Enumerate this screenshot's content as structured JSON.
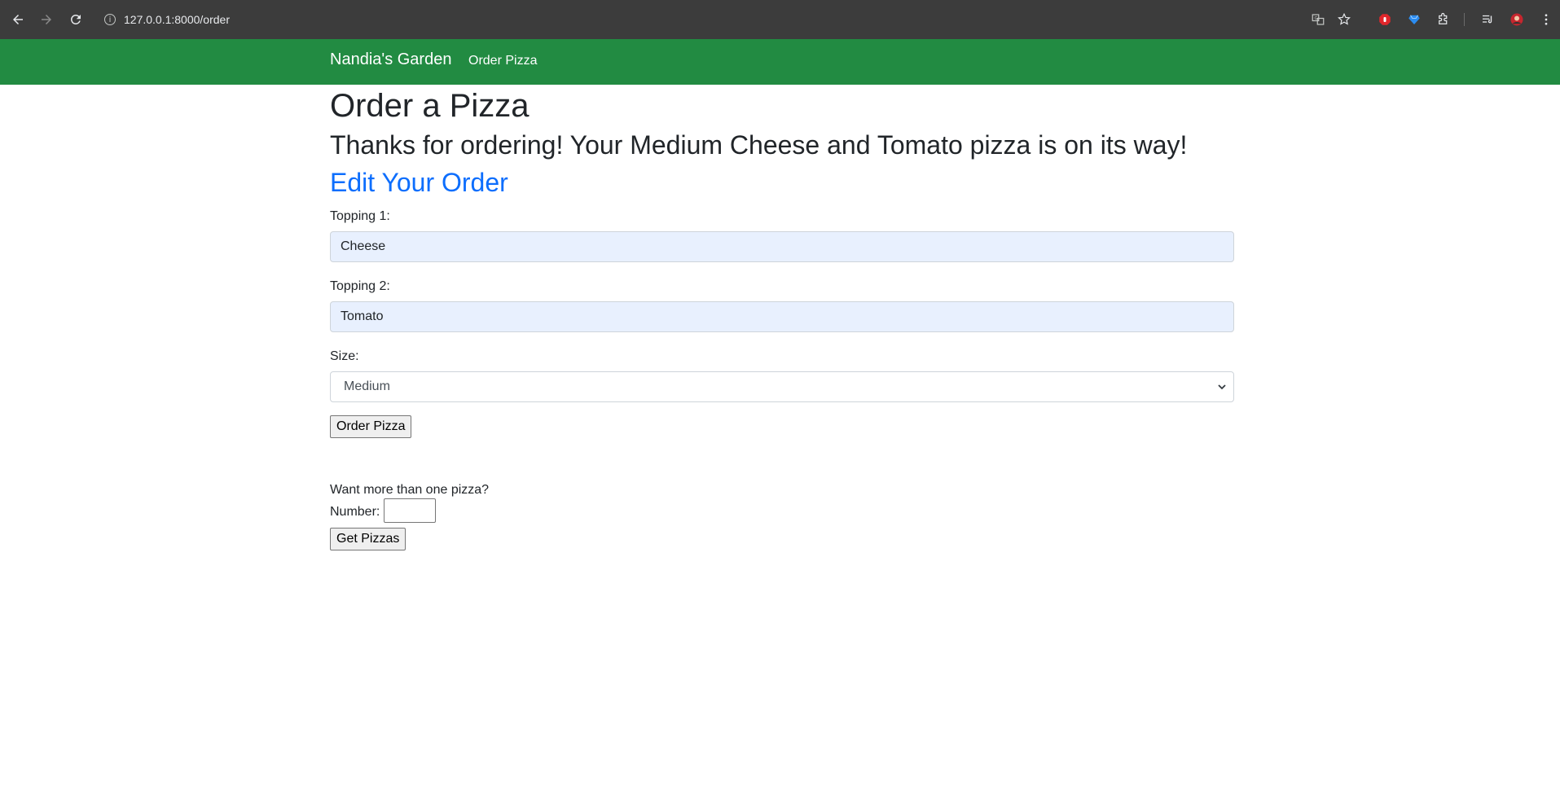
{
  "browser": {
    "url": "127.0.0.1:8000/order"
  },
  "navbar": {
    "brand": "Nandia's Garden",
    "links": [
      "Order Pizza"
    ]
  },
  "page": {
    "title": "Order a Pizza",
    "confirmation": "Thanks for ordering! Your Medium Cheese and Tomato pizza is on its way!",
    "edit_heading": "Edit Your Order"
  },
  "form": {
    "topping1_label": "Topping 1:",
    "topping1_value": "Cheese",
    "topping2_label": "Topping 2:",
    "topping2_value": "Tomato",
    "size_label": "Size:",
    "size_value": "Medium",
    "submit_label": "Order Pizza"
  },
  "multi": {
    "prompt": "Want more than one pizza?",
    "number_label": "Number:",
    "number_value": "",
    "submit_label": "Get Pizzas"
  },
  "colors": {
    "navbar_bg": "#228b42",
    "link": "#0d6efd",
    "autofill_bg": "#e8f0fe"
  }
}
